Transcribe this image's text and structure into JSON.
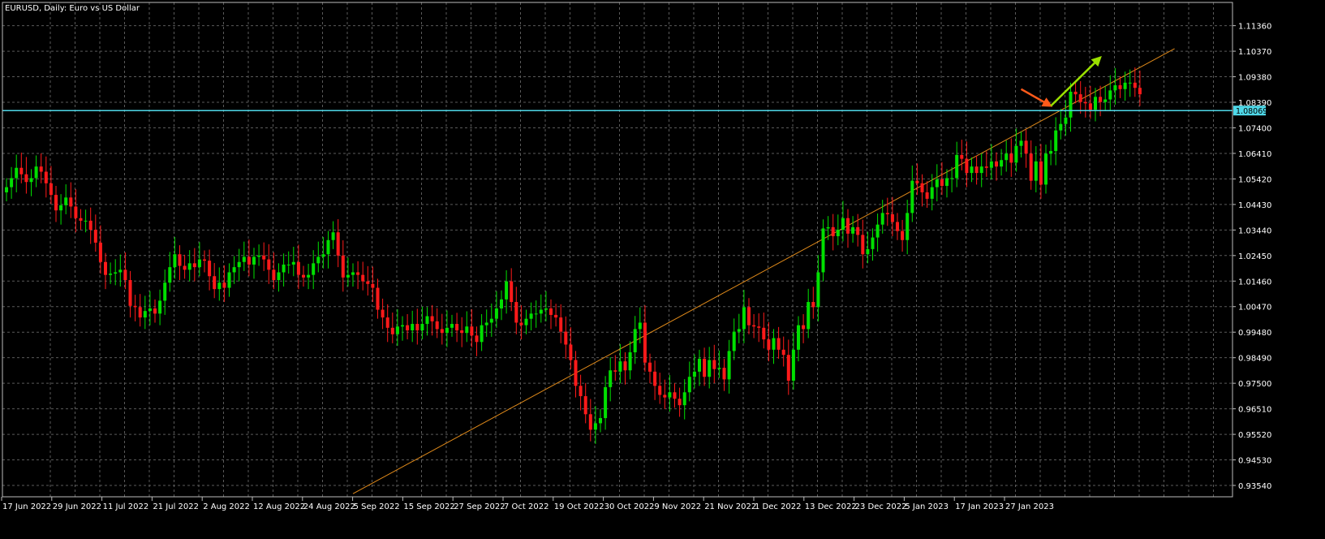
{
  "header": {
    "title": "EURUSD, Daily:  Euro vs US Dollar"
  },
  "colors": {
    "background": "#000000",
    "grid": "#5a5a5a",
    "axis": "#bdbdbd",
    "bull": "#00e000",
    "bear": "#ff1a1a",
    "price_line": "#4fd8e8",
    "trend_line": "#e08a1a",
    "arrow_up": "#9be000",
    "arrow_down": "#ff5a1a"
  },
  "chart_data": {
    "type": "candlestick",
    "title": "EURUSD, Daily:  Euro vs US Dollar",
    "ylim": [
      0.931,
      1.1226
    ],
    "y_ticks": [
      "1.11360",
      "1.10370",
      "1.09380",
      "1.08390",
      "1.07400",
      "1.06410",
      "1.05420",
      "1.04430",
      "1.03440",
      "1.02450",
      "1.01460",
      "1.00470",
      "0.99480",
      "0.98490",
      "0.97500",
      "0.96510",
      "0.95520",
      "0.94530",
      "0.93540"
    ],
    "x_labels": [
      "17 Jun 2022",
      "29 Jun 2022",
      "11 Jul 2022",
      "21 Jul 2022",
      "2 Aug 2022",
      "12 Aug 2022",
      "24 Aug 2022",
      "5 Sep 2022",
      "15 Sep 2022",
      "27 Sep 2022",
      "7 Oct 2022",
      "19 Oct 2022",
      "30 Oct 2022",
      "9 Nov 2022",
      "21 Nov 2022",
      "1 Dec 2022",
      "13 Dec 2022",
      "23 Dec 2022",
      "5 Jan 2023",
      "17 Jan 2023",
      "27 Jan 2023"
    ],
    "grid": true,
    "current_price": {
      "value": 1.08069,
      "label": "1.08069"
    },
    "trend_line": {
      "from": {
        "bar": 70,
        "price": 0.9322
      },
      "to": {
        "bar": 236,
        "price": 1.1047
      }
    },
    "arrows": [
      {
        "name": "down-arrow",
        "from": {
          "bar": 205,
          "price": 1.089
        },
        "to": {
          "bar": 211,
          "price": 1.0825
        }
      },
      {
        "name": "up-arrow",
        "from": {
          "bar": 211,
          "price": 1.0825
        },
        "to": {
          "bar": 221,
          "price": 1.1013
        }
      }
    ],
    "closes": [
      1.051,
      1.0545,
      1.0585,
      1.056,
      1.053,
      1.0545,
      1.059,
      1.057,
      1.0525,
      1.048,
      1.042,
      1.044,
      1.047,
      1.0435,
      1.039,
      1.038,
      1.038,
      1.0345,
      1.0295,
      1.022,
      1.017,
      1.0175,
      1.018,
      1.019,
      1.015,
      1.005,
      1.0045,
      1.0005,
      1.003,
      1.004,
      1.002,
      1.007,
      1.014,
      1.02,
      1.025,
      1.0205,
      1.019,
      1.0215,
      1.02,
      1.023,
      1.0225,
      1.0165,
      1.0115,
      1.014,
      1.012,
      1.018,
      1.02,
      1.022,
      1.024,
      1.021,
      1.024,
      1.0245,
      1.023,
      1.019,
      1.015,
      1.018,
      1.021,
      1.021,
      1.022,
      1.017,
      1.016,
      1.017,
      1.0215,
      1.024,
      1.025,
      1.0305,
      1.0335,
      1.0245,
      1.016,
      1.017,
      1.018,
      1.017,
      1.0145,
      1.0135,
      1.012,
      1.0035,
      1.0005,
      0.9965,
      0.994,
      0.997,
      0.9975,
      0.9955,
      0.998,
      0.9955,
      0.998,
      1.001,
      0.999,
      0.996,
      0.9945,
      0.9965,
      0.998,
      0.9955,
      0.9945,
      0.997,
      0.9935,
      0.991,
      0.9975,
      0.9985,
      1.0,
      1.004,
      1.0075,
      1.0145,
      1.0065,
      0.9985,
      0.9975,
      1.0,
      1.002,
      1.002,
      1.0035,
      1.004,
      1.0015,
      1.0005,
      0.995,
      0.99,
      0.984,
      0.974,
      0.97,
      0.963,
      0.957,
      0.9595,
      0.9615,
      0.9735,
      0.98,
      0.9795,
      0.9835,
      0.98,
      0.987,
      0.996,
      0.9985,
      0.983,
      0.9795,
      0.974,
      0.9705,
      0.9695,
      0.9715,
      0.969,
      0.9665,
      0.9715,
      0.9775,
      0.9795,
      0.9845,
      0.9775,
      0.984,
      0.9805,
      0.981,
      0.9765,
      0.9875,
      0.995,
      0.996,
      1.0045,
      0.9975,
      0.997,
      0.9965,
      0.992,
      0.988,
      0.9925,
      0.988,
      0.986,
      0.976,
      0.988,
      0.9975,
      0.996,
      1.0065,
      1.0045,
      1.018,
      1.035,
      1.0355,
      1.032,
      1.0345,
      1.039,
      1.033,
      1.0355,
      1.0325,
      1.025,
      1.027,
      1.0315,
      1.0365,
      1.041,
      1.0405,
      1.0375,
      1.034,
      1.0305,
      1.041,
      1.0535,
      1.0525,
      1.049,
      1.0465,
      1.051,
      1.054,
      1.0515,
      1.0545,
      1.0545,
      1.0635,
      1.062,
      1.0565,
      1.059,
      1.0565,
      1.059,
      1.0585,
      1.061,
      1.059,
      1.0615,
      1.064,
      1.0605,
      1.067,
      1.069,
      1.064,
      1.0535,
      1.061,
      1.052,
      1.064,
      1.065,
      1.073,
      1.0755,
      1.078,
      1.088,
      1.087,
      1.084,
      1.0835,
      1.081,
      1.086,
      1.084,
      1.085,
      1.0885,
      1.0905,
      1.089,
      1.0915,
      1.0915,
      1.0895,
      1.087
    ],
    "opens": [
      1.049,
      1.051,
      1.0545,
      1.0585,
      1.056,
      1.053,
      1.0545,
      1.059,
      1.057,
      1.0525,
      1.048,
      1.042,
      1.044,
      1.047,
      1.0435,
      1.039,
      1.038,
      1.038,
      1.0345,
      1.0295,
      1.022,
      1.017,
      1.0175,
      1.018,
      1.019,
      1.015,
      1.005,
      1.0045,
      1.0005,
      1.003,
      1.004,
      1.002,
      1.007,
      1.014,
      1.02,
      1.025,
      1.0205,
      1.019,
      1.0215,
      1.02,
      1.023,
      1.0225,
      1.0165,
      1.0115,
      1.014,
      1.012,
      1.018,
      1.02,
      1.022,
      1.024,
      1.021,
      1.024,
      1.0245,
      1.023,
      1.019,
      1.015,
      1.018,
      1.021,
      1.021,
      1.022,
      1.017,
      1.016,
      1.017,
      1.0215,
      1.024,
      1.025,
      1.0305,
      1.0335,
      1.0245,
      1.016,
      1.017,
      1.018,
      1.017,
      1.0145,
      1.0135,
      1.012,
      1.0035,
      1.0005,
      0.9965,
      0.994,
      0.997,
      0.9975,
      0.9955,
      0.998,
      0.9955,
      0.998,
      1.001,
      0.999,
      0.996,
      0.9945,
      0.9965,
      0.998,
      0.9955,
      0.9945,
      0.997,
      0.9935,
      0.991,
      0.9975,
      0.9985,
      1.0,
      1.004,
      1.0075,
      1.0145,
      1.0065,
      0.9985,
      0.9975,
      1.0,
      1.002,
      1.002,
      1.0035,
      1.004,
      1.0015,
      1.0005,
      0.995,
      0.99,
      0.984,
      0.974,
      0.97,
      0.963,
      0.957,
      0.9595,
      0.9615,
      0.9735,
      0.98,
      0.9795,
      0.9835,
      0.98,
      0.987,
      0.996,
      0.9985,
      0.983,
      0.9795,
      0.974,
      0.9705,
      0.9695,
      0.9715,
      0.969,
      0.9665,
      0.9715,
      0.9775,
      0.9795,
      0.9845,
      0.9775,
      0.984,
      0.9805,
      0.981,
      0.9765,
      0.9875,
      0.995,
      0.996,
      1.0045,
      0.9975,
      0.997,
      0.9965,
      0.992,
      0.988,
      0.9925,
      0.988,
      0.986,
      0.976,
      0.988,
      0.9975,
      0.996,
      1.0065,
      1.0045,
      1.018,
      1.035,
      1.0355,
      1.032,
      1.0345,
      1.039,
      1.033,
      1.0355,
      1.0325,
      1.025,
      1.027,
      1.0315,
      1.0365,
      1.041,
      1.0405,
      1.0375,
      1.034,
      1.0305,
      1.041,
      1.0535,
      1.0525,
      1.049,
      1.0465,
      1.051,
      1.054,
      1.0515,
      1.0545,
      1.0545,
      1.0635,
      1.062,
      1.0565,
      1.059,
      1.0565,
      1.059,
      1.0585,
      1.061,
      1.059,
      1.0615,
      1.064,
      1.0605,
      1.067,
      1.069,
      1.064,
      1.0535,
      1.061,
      1.052,
      1.064,
      1.065,
      1.073,
      1.0755,
      1.078,
      1.088,
      1.087,
      1.084,
      1.0835,
      1.081,
      1.086,
      1.084,
      1.085,
      1.0885,
      1.0905,
      1.089,
      1.0915,
      1.0915,
      1.0895
    ]
  }
}
